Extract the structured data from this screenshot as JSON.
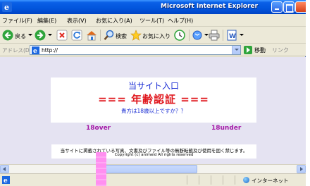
{
  "window": {
    "title": "Microsoft Internet Explorer"
  },
  "menu": {
    "items": [
      "ファイル(F)",
      "編集(E)",
      "表示(V)",
      "お気に入り(A)",
      "ツール(T)",
      "ヘルプ(H)"
    ]
  },
  "toolbar": {
    "back_label": "戻る",
    "search_label": "検索",
    "favorites_label": "お気に入り"
  },
  "address": {
    "label": "アドレス(D)",
    "value": "http://",
    "go_label": "移動",
    "links_label": "リンク"
  },
  "page": {
    "site_title": "当サイト入口",
    "age_title": "=== 年齢認証 ===",
    "question": "貴方は18歳以上ですか？？",
    "over_link": "18over",
    "under_link": "18under",
    "notice": "当サイトに掲載されている写真、文書及びファイル等の無断転載及び使用を固く禁じます。",
    "copyright": "Copyright (c) animeid All rights reserved"
  },
  "status": {
    "zone": "インターネット"
  },
  "colors": {
    "title_blue": "#1a2dd4",
    "age_red": "#e0181e",
    "link_purple": "#a51aa8",
    "page_bg": "#e5e3f2"
  },
  "icons": [
    "ie-logo",
    "back-arrow",
    "forward-arrow",
    "stop",
    "refresh",
    "home",
    "search",
    "favorites",
    "history",
    "mail",
    "print",
    "word"
  ]
}
